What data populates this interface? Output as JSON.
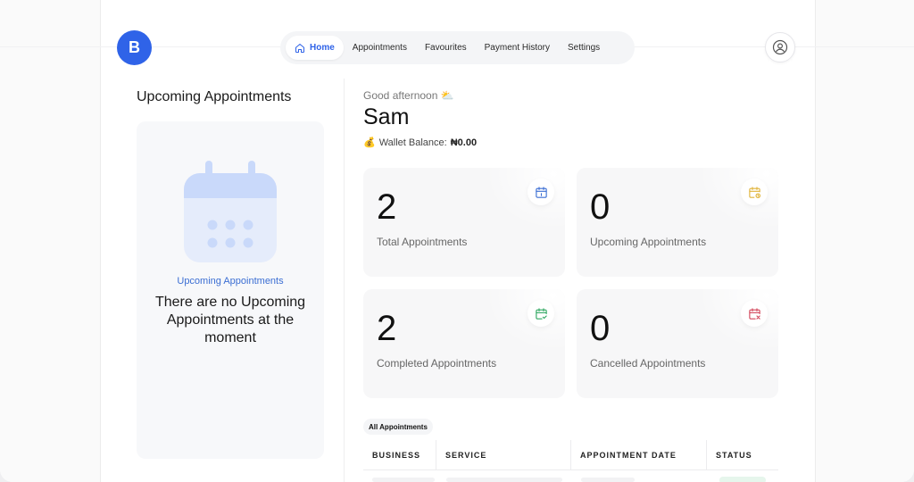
{
  "brand": {
    "logo_letter": "B",
    "color": "#2f63e8"
  },
  "nav": {
    "items": [
      {
        "label": "Home",
        "icon": "home-icon",
        "active": true
      },
      {
        "label": "Appointments",
        "active": false
      },
      {
        "label": "Favourites",
        "active": false
      },
      {
        "label": "Payment History",
        "active": false
      },
      {
        "label": "Settings",
        "active": false
      }
    ]
  },
  "header": {
    "avatar_icon": "user-circle-icon"
  },
  "left_panel": {
    "title": "Upcoming Appointments",
    "illustration": "calendar-illustration",
    "caption": "Upcoming Appointments",
    "message": "There are no Upcoming Appointments at the moment"
  },
  "greeting": {
    "text": "Good afternoon ⛅",
    "name": "Sam",
    "wallet_icon": "💰",
    "wallet_label": "Wallet Balance:",
    "wallet_value": "₦0.00"
  },
  "stats": [
    {
      "value": "2",
      "label": "Total Appointments",
      "icon": "calendar-icon",
      "color": "#3b6ed3"
    },
    {
      "value": "0",
      "label": "Upcoming Appointments",
      "icon": "calendar-clock-icon",
      "color": "#e0b43a"
    },
    {
      "value": "2",
      "label": "Completed Appointments",
      "icon": "calendar-check-icon",
      "color": "#2fa760"
    },
    {
      "value": "0",
      "label": "Cancelled Appointments",
      "icon": "calendar-x-icon",
      "color": "#d2455a"
    }
  ],
  "table": {
    "filter_label": "All Appointments",
    "columns": [
      "BUSINESS",
      "SERVICE",
      "APPOINTMENT DATE",
      "STATUS"
    ]
  }
}
